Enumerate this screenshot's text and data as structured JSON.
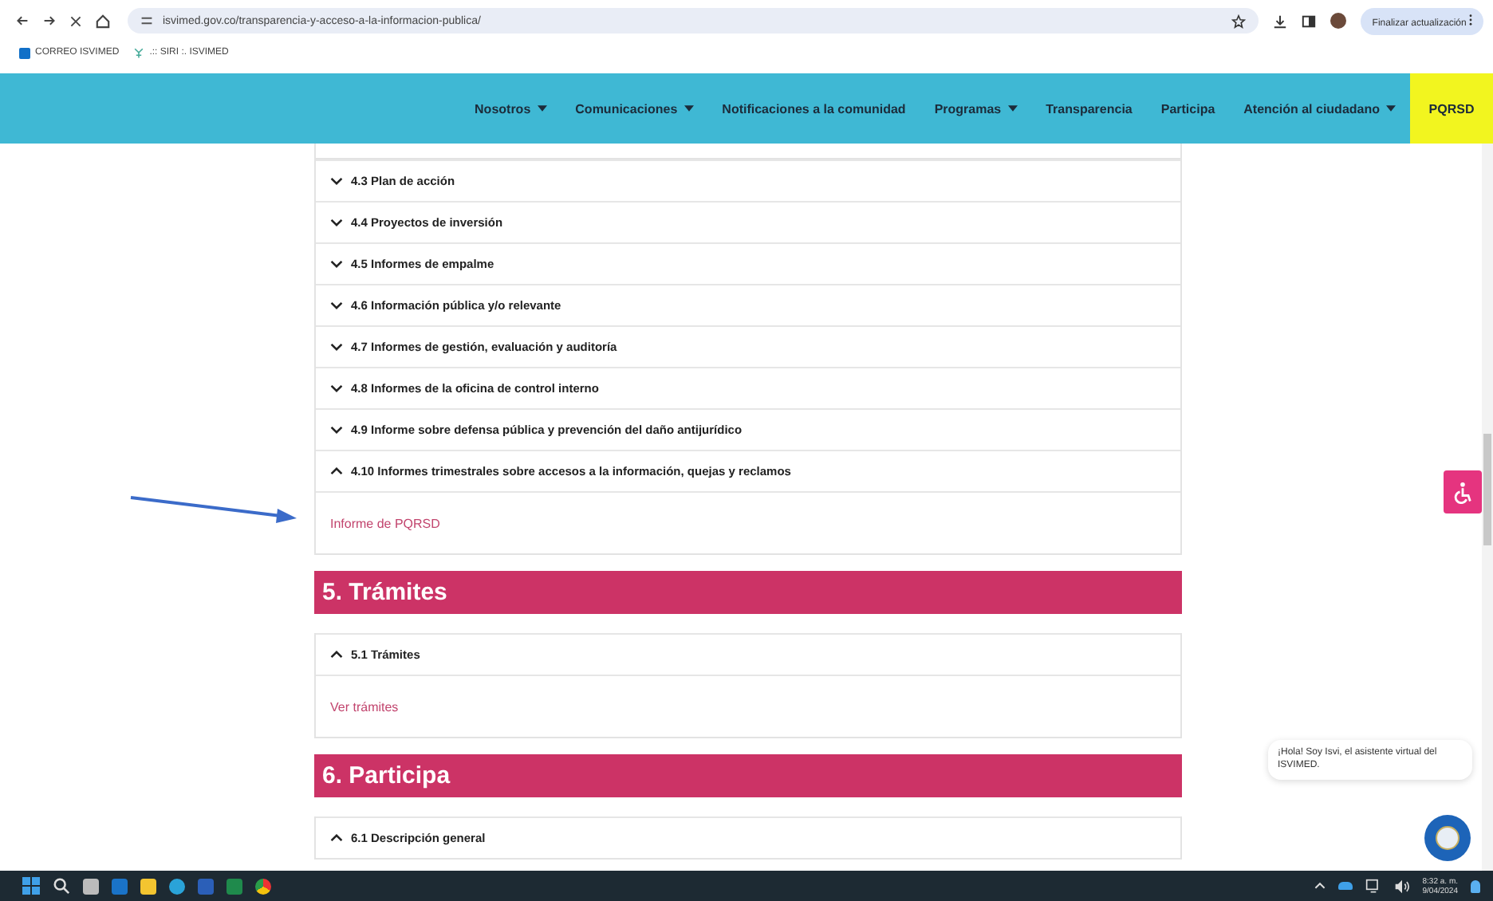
{
  "browser": {
    "url": "isvimed.gov.co/transparencia-y-acceso-a-la-informacion-publica/",
    "update_button": "Finalizar actualización",
    "bookmarks": [
      "CORREO ISVIMED",
      ".:: SIRI :. ISVIMED"
    ]
  },
  "nav": {
    "items": [
      {
        "label": "Nosotros",
        "dropdown": true,
        "highlight": false
      },
      {
        "label": "Comunicaciones",
        "dropdown": true,
        "highlight": false
      },
      {
        "label": "Notificaciones a la comunidad",
        "dropdown": false,
        "highlight": false
      },
      {
        "label": "Programas",
        "dropdown": true,
        "highlight": false
      },
      {
        "label": "Transparencia",
        "dropdown": false,
        "highlight": false
      },
      {
        "label": "Participa",
        "dropdown": false,
        "highlight": false
      },
      {
        "label": "Atención al ciudadano",
        "dropdown": true,
        "highlight": false
      },
      {
        "label": "PQRSD",
        "dropdown": false,
        "highlight": true
      }
    ]
  },
  "sections": [
    {
      "items": [
        {
          "label": "4.3 Plan de acción",
          "expanded": false
        },
        {
          "label": "4.4 Proyectos de inversión",
          "expanded": false
        },
        {
          "label": "4.5 Informes de empalme",
          "expanded": false
        },
        {
          "label": "4.6 Información pública y/o relevante",
          "expanded": false
        },
        {
          "label": "4.7 Informes de gestión, evaluación y auditoría",
          "expanded": false
        },
        {
          "label": "4.8 Informes de la oficina de control interno",
          "expanded": false
        },
        {
          "label": "4.9 Informe sobre defensa pública y prevención del daño antijurídico",
          "expanded": false
        },
        {
          "label": "4.10 Informes trimestrales sobre accesos a la información, quejas y reclamos",
          "expanded": true,
          "link": "Informe de PQRSD"
        }
      ]
    },
    {
      "heading": "5. Trámites",
      "items": [
        {
          "label": "5.1 Trámites",
          "expanded": true,
          "link": "Ver trámites"
        }
      ]
    },
    {
      "heading": "6. Participa",
      "items": [
        {
          "label": "6.1 Descripción general",
          "expanded": true
        }
      ]
    }
  ],
  "chat": {
    "message": "¡Hola! Soy Isvi, el asistente virtual del ISVIMED."
  },
  "taskbar": {
    "time": "8:32 a. m.",
    "date": "9/04/2024"
  }
}
